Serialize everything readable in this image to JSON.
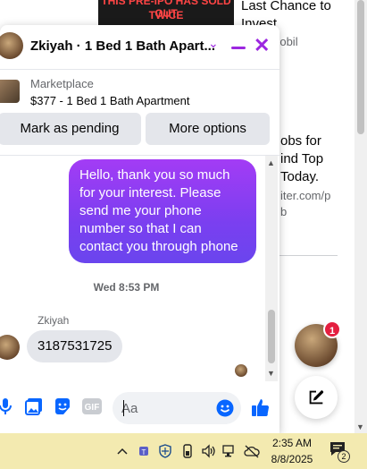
{
  "background": {
    "ad_image_text_1": "THIS PRE-IPO HAS SOLD OUT",
    "ad_image_text_2": "TWICE",
    "ad_title": "Last Chance to Invest",
    "ad_source": "modemobil",
    "ad2_title_lines": [
      "obs for",
      "ind Top",
      "Today."
    ],
    "ad2_source_lines": [
      "iter.com/p",
      "b"
    ]
  },
  "chat": {
    "title": "Zkiyah · 1 Bed 1 Bath Apart...",
    "marketplace_label": "Marketplace",
    "listing_title": "$377 - 1 Bed 1 Bath Apartment",
    "actions": {
      "pending": "Mark as pending",
      "more": "More options"
    },
    "messages": {
      "outgoing": "Hello, thank you so much for your interest. Please send me your phone number so that I can contact you through phone",
      "timestamp": "Wed 8:53 PM",
      "sender_name": "Zkiyah",
      "incoming": "3187531725"
    },
    "composer": {
      "placeholder": "Aa"
    },
    "colors": {
      "accent": "#9c27e0",
      "bubble_gradient_top": "#a33cf5",
      "bubble_gradient_bottom": "#6a45ee",
      "like": "#0866ff"
    }
  },
  "chat_heads": {
    "badge_count": "1"
  },
  "taskbar": {
    "time": "2:35 AM",
    "date": "8/8/2025",
    "notification_count": "2"
  }
}
